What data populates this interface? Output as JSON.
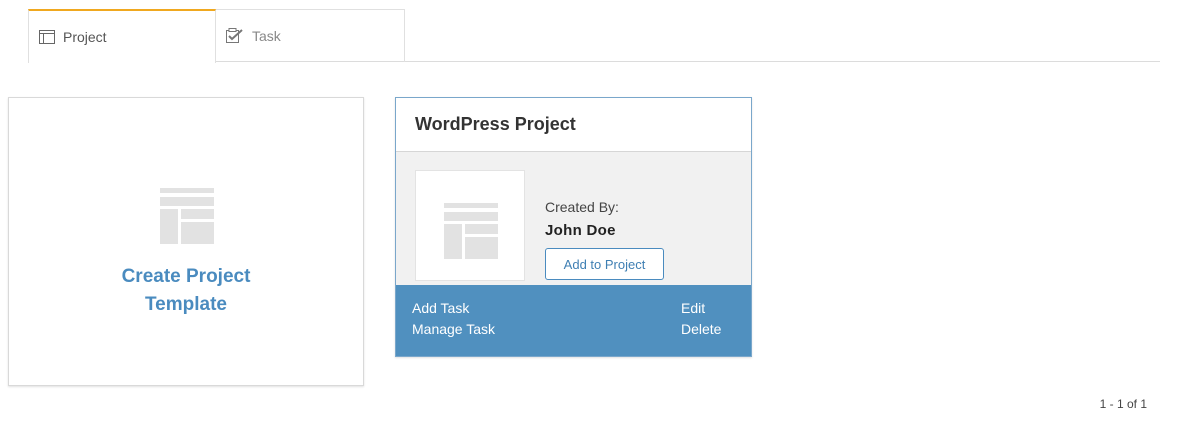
{
  "tabs": [
    {
      "label": "Project",
      "icon": "folder-icon",
      "active": true
    },
    {
      "label": "Task",
      "icon": "task-check-icon",
      "active": false
    }
  ],
  "create_card": {
    "label": "Create Project Template",
    "icon": "template-layout-icon"
  },
  "project_card": {
    "title": "WordPress Project",
    "created_by_label": "Created By:",
    "created_by_name": "John Doe",
    "add_button": "Add to Project",
    "thumbnail_icon": "template-layout-icon",
    "footer": {
      "add_task": "Add Task",
      "manage_task": "Manage Task",
      "edit": "Edit",
      "delete": "Delete"
    }
  },
  "pagination": {
    "text": "1 - 1 of 1"
  },
  "colors": {
    "accent_tab": "#f0a81f",
    "link_blue": "#4a8bbf",
    "footer_blue": "#5090bf",
    "card_border_blue": "#7aa7cb"
  }
}
